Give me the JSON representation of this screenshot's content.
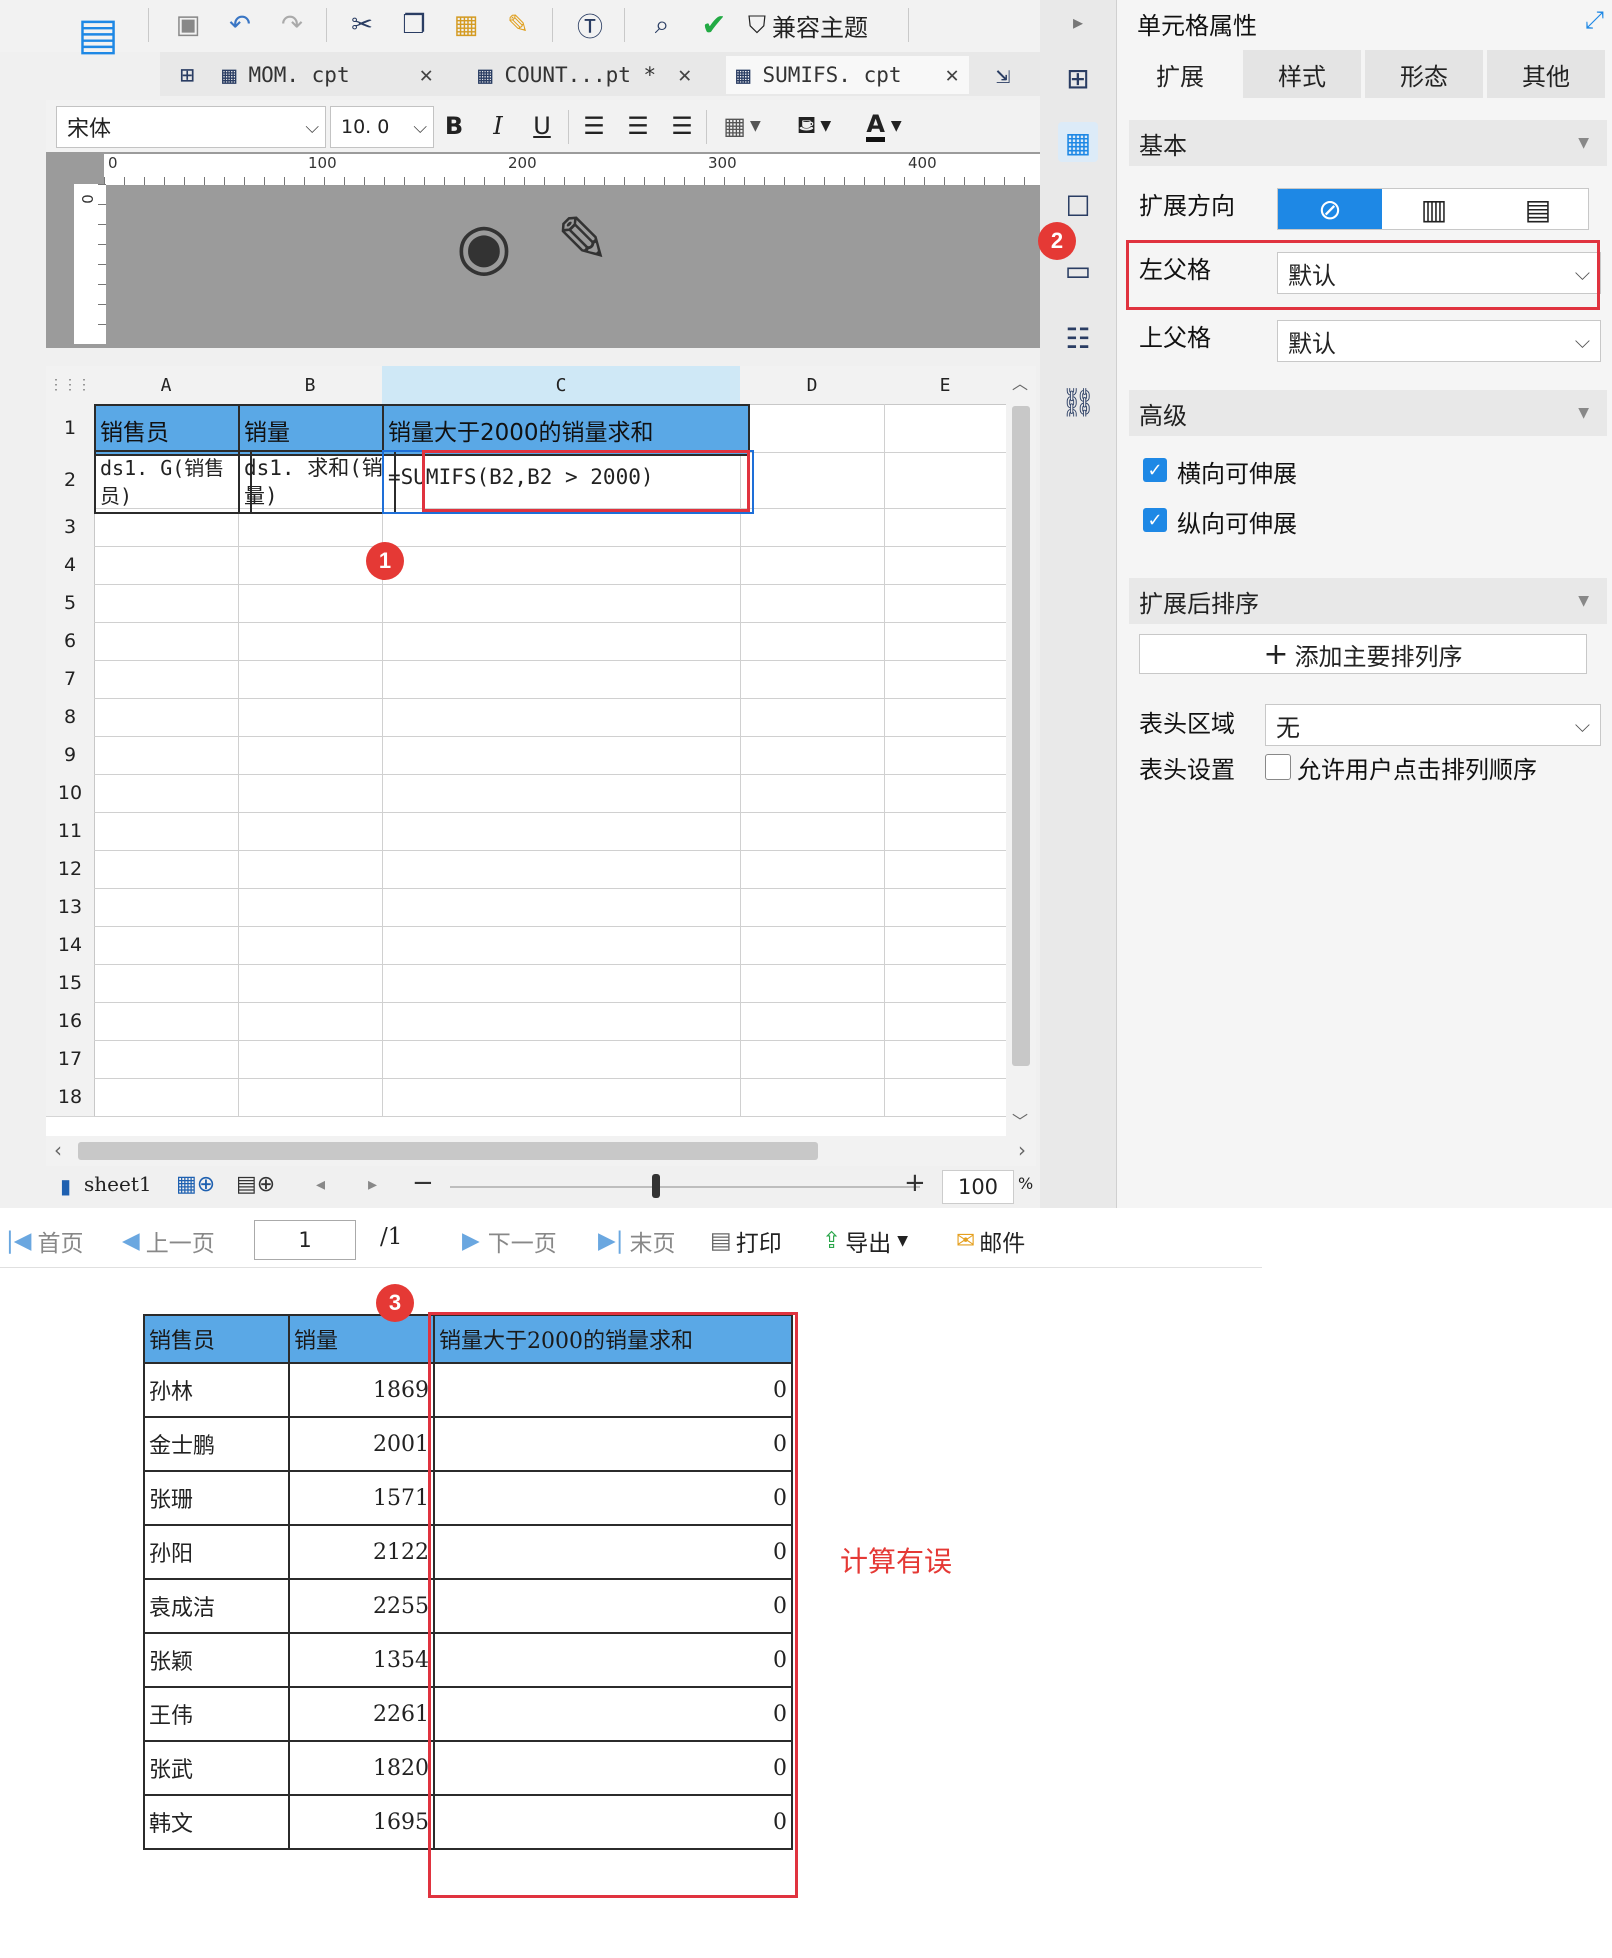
{
  "toolbar": {
    "compat_label": "兼容主题"
  },
  "tabs": [
    {
      "label": "MOM. cpt"
    },
    {
      "label": "COUNT...pt *"
    },
    {
      "label": "SUMIFS. cpt"
    }
  ],
  "format": {
    "font": "宋体",
    "size": "10. 0",
    "bold": "B",
    "italic": "I",
    "underline": "U",
    "font_color": "A"
  },
  "ruler": [
    "0",
    "100",
    "200",
    "300",
    "400"
  ],
  "vruler": "0",
  "sheet": {
    "columns": [
      "A",
      "B",
      "C",
      "D",
      "E"
    ],
    "rows": [
      "1",
      "2",
      "3",
      "4",
      "5",
      "6",
      "7",
      "8",
      "9",
      "10",
      "11",
      "12",
      "13",
      "14",
      "15",
      "16",
      "17",
      "18"
    ],
    "header_cells": [
      "销售员",
      "销量",
      "销量大于2000的销量求和"
    ],
    "a2": "ds1. G(销售员)",
    "b2": "ds1. 求和(销量)",
    "c2": "=SUMIFS(B2,B2 > 2000)",
    "sheet_name": "sheet1",
    "zoom": "100",
    "zoom_unit": "%"
  },
  "panel": {
    "title": "单元格属性",
    "tabs": [
      "扩展",
      "样式",
      "形态",
      "其他"
    ],
    "basic": "基本",
    "expand_dir": "扩展方向",
    "left_parent": "左父格",
    "left_parent_value": "默认",
    "top_parent": "上父格",
    "top_parent_value": "默认",
    "advanced": "高级",
    "h_expand": "横向可伸展",
    "v_expand": "纵向可伸展",
    "sort": "扩展后排序",
    "add_sort": "添加主要排列序",
    "header_area": "表头区域",
    "header_area_value": "无",
    "header_setting": "表头设置",
    "allow_sort": "允许用户点击排列顺序"
  },
  "preview_nav": {
    "first": "首页",
    "prev": "上一页",
    "page": "1",
    "total": "/1",
    "next": "下一页",
    "last": "末页",
    "print": "打印",
    "export": "导出",
    "mail": "邮件"
  },
  "report": {
    "headers": [
      "销售员",
      "销量",
      "销量大于2000的销量求和"
    ],
    "rows": [
      {
        "name": "孙林",
        "qty": "1869",
        "sum": "0"
      },
      {
        "name": "金士鹏",
        "qty": "2001",
        "sum": "0"
      },
      {
        "name": "张珊",
        "qty": "1571",
        "sum": "0"
      },
      {
        "name": "孙阳",
        "qty": "2122",
        "sum": "0"
      },
      {
        "name": "袁成洁",
        "qty": "2255",
        "sum": "0"
      },
      {
        "name": "张颖",
        "qty": "1354",
        "sum": "0"
      },
      {
        "name": "王伟",
        "qty": "2261",
        "sum": "0"
      },
      {
        "name": "张武",
        "qty": "1820",
        "sum": "0"
      },
      {
        "name": "韩文",
        "qty": "1695",
        "sum": "0"
      }
    ]
  },
  "annotations": {
    "badge1": "1",
    "badge2": "2",
    "badge3": "3",
    "error_note": "计算有误"
  },
  "colors": {
    "header_blue": "#5aa8e6",
    "annotation_red": "#e0333f",
    "accent_blue": "#1e88e5"
  }
}
